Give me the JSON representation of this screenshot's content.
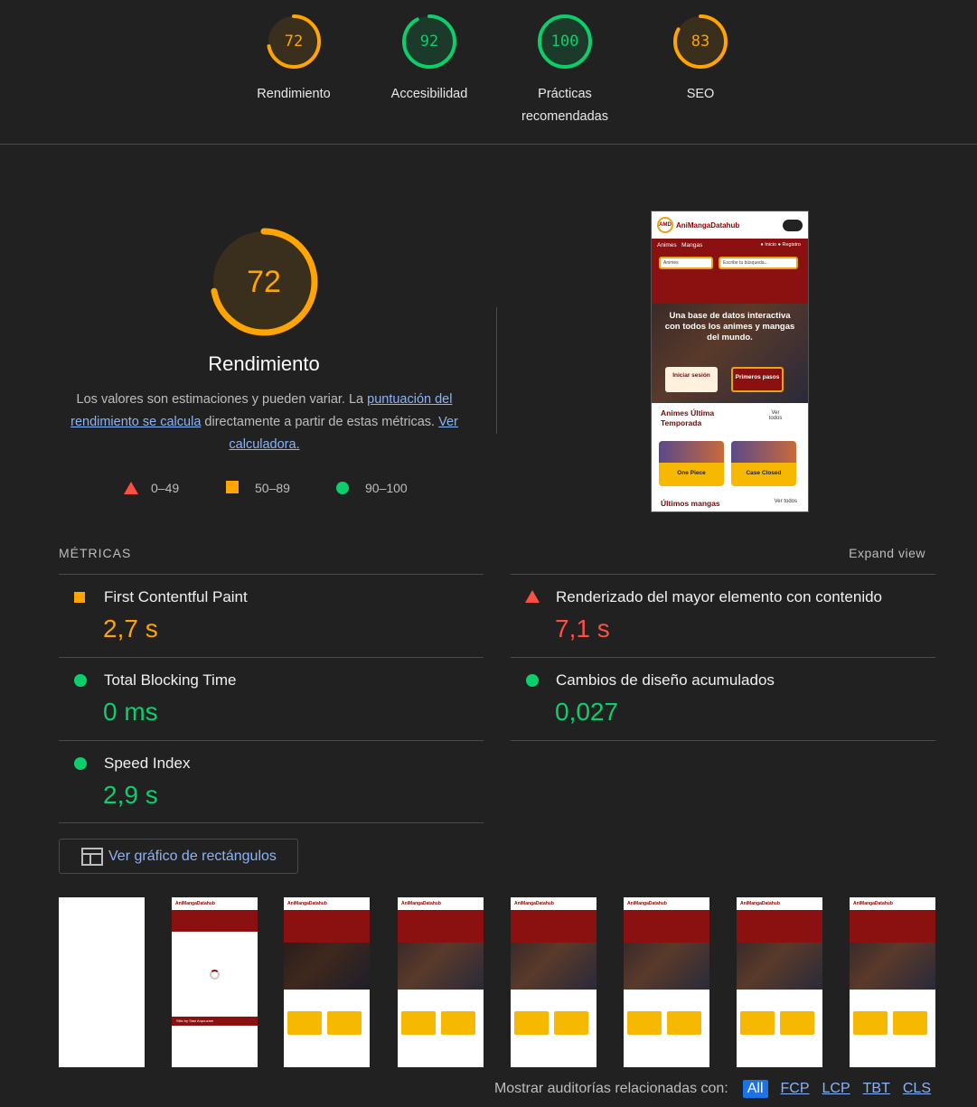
{
  "categories": [
    {
      "key": "performance",
      "score": "72",
      "label": "Rendimiento",
      "color": "#ffa400",
      "fraction": 0.72
    },
    {
      "key": "accessibility",
      "score": "92",
      "label": "Accesibilidad",
      "color": "#0cce6b",
      "fraction": 0.92
    },
    {
      "key": "best-practices",
      "score": "100",
      "label": "Prácticas recomendadas",
      "color": "#0cce6b",
      "fraction": 1.0
    },
    {
      "key": "seo",
      "score": "83",
      "label": "SEO",
      "color": "#ffa400",
      "fraction": 0.83
    }
  ],
  "main": {
    "score": "72",
    "fraction": 0.72,
    "title": "Rendimiento",
    "desc_before": "Los valores son estimaciones y pueden variar. La ",
    "desc_link1": "puntuación del rendimiento se calcula",
    "desc_middle": " directamente a partir de estas métricas. ",
    "desc_link2": "Ver calculadora."
  },
  "legend": {
    "fail": "0–49",
    "average": "50–89",
    "pass": "90–100"
  },
  "screenshot": {
    "site_name": "AniMangaDatahub",
    "logo_text": "AMD",
    "nav_animes": "Animes",
    "nav_mangas": "Mangas",
    "login": "Inicio",
    "register": "Registro",
    "select_value": "Animes",
    "search_placeholder": "Escribe tu búsqueda...",
    "hero_text": "Una base de datos interactiva con todos los animes y mangas del mundo.",
    "btn_login": "Iniciar sesión",
    "btn_start": "Primeros pasos",
    "section1": "Animes Última Temporada",
    "see_all1": "Ver todos",
    "card1": "One Piece",
    "card2": "Case Closed",
    "section2": "Últimos mangas",
    "see_all2": "Ver todos"
  },
  "metrics": {
    "title": "MÉTRICAS",
    "expand": "Expand view",
    "items": [
      {
        "name": "First Contentful Paint",
        "value": "2,7 s",
        "status": "average"
      },
      {
        "name": "Renderizado del mayor elemento con contenido",
        "value": "7,1 s",
        "status": "fail"
      },
      {
        "name": "Total Blocking Time",
        "value": "0 ms",
        "status": "pass"
      },
      {
        "name": "Cambios de diseño acumulados",
        "value": "0,027",
        "status": "pass"
      },
      {
        "name": "Speed Index",
        "value": "2,9 s",
        "status": "pass"
      }
    ]
  },
  "treemap_button": "Ver gráfico de rectángulos",
  "filmstrip_footer_text": "Sitio by Sasi Arquuzam",
  "filters": {
    "label": "Mostrar auditorías relacionadas con:",
    "options": [
      "All",
      "FCP",
      "LCP",
      "TBT",
      "CLS"
    ],
    "active": "All"
  }
}
